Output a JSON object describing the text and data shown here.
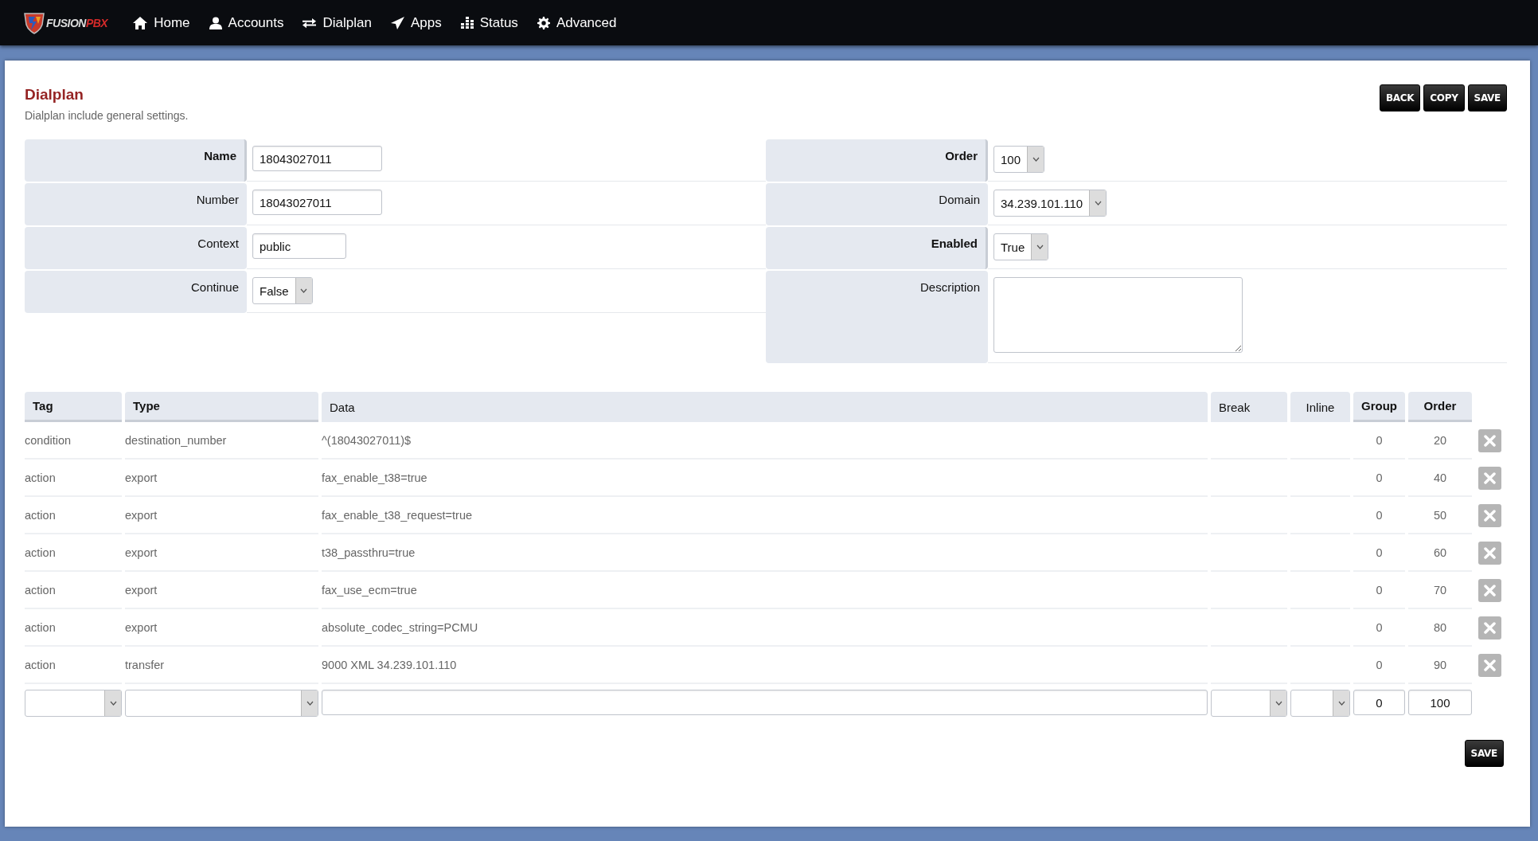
{
  "nav": {
    "logo": {
      "word": "FUSION",
      "accent": "PBX"
    },
    "items": [
      {
        "label": "Home"
      },
      {
        "label": "Accounts"
      },
      {
        "label": "Dialplan"
      },
      {
        "label": "Apps"
      },
      {
        "label": "Status"
      },
      {
        "label": "Advanced"
      }
    ]
  },
  "page": {
    "title": "Dialplan",
    "description": "Dialplan include general settings.",
    "buttons": [
      "BACK",
      "COPY",
      "SAVE"
    ]
  },
  "form": {
    "left": [
      {
        "label": "Name",
        "required": true,
        "kind": "text",
        "value": "18043027011"
      },
      {
        "label": "Number",
        "required": false,
        "kind": "text",
        "value": "18043027011"
      },
      {
        "label": "Context",
        "required": false,
        "kind": "text",
        "value": "public"
      },
      {
        "label": "Continue",
        "required": false,
        "kind": "select",
        "value": "False"
      }
    ],
    "right": [
      {
        "label": "Order",
        "required": true,
        "kind": "select",
        "value": "100"
      },
      {
        "label": "Domain",
        "required": false,
        "kind": "select",
        "value": "34.239.101.110"
      },
      {
        "label": "Enabled",
        "required": true,
        "kind": "select",
        "value": "True"
      },
      {
        "label": "Description",
        "required": false,
        "kind": "textarea"
      }
    ]
  },
  "table": {
    "columns": [
      {
        "label": "Tag",
        "sortable": true
      },
      {
        "label": "Type",
        "sortable": true
      },
      {
        "label": "Data",
        "sortable": false
      },
      {
        "label": "Break",
        "sortable": false
      },
      {
        "label": "Inline",
        "sortable": false
      },
      {
        "label": "Group",
        "sortable": true
      },
      {
        "label": "Order",
        "sortable": true
      }
    ],
    "rows": [
      {
        "tag": "condition",
        "type": "destination_number",
        "data": "^(18043027011)$",
        "group": "0",
        "order": "20"
      },
      {
        "tag": "action",
        "type": "export",
        "data": "fax_enable_t38=true",
        "group": "0",
        "order": "40"
      },
      {
        "tag": "action",
        "type": "export",
        "data": "fax_enable_t38_request=true",
        "group": "0",
        "order": "50"
      },
      {
        "tag": "action",
        "type": "export",
        "data": "t38_passthru=true",
        "group": "0",
        "order": "60"
      },
      {
        "tag": "action",
        "type": "export",
        "data": "fax_use_ecm=true",
        "group": "0",
        "order": "70"
      },
      {
        "tag": "action",
        "type": "export",
        "data": "absolute_codec_string=PCMU",
        "group": "0",
        "order": "80"
      },
      {
        "tag": "action",
        "type": "transfer",
        "data": "9000 XML 34.239.101.110",
        "group": "0",
        "order": "90"
      }
    ],
    "new_row": {
      "group": "0",
      "order": "100"
    }
  },
  "footer_buttons": [
    "SAVE"
  ]
}
